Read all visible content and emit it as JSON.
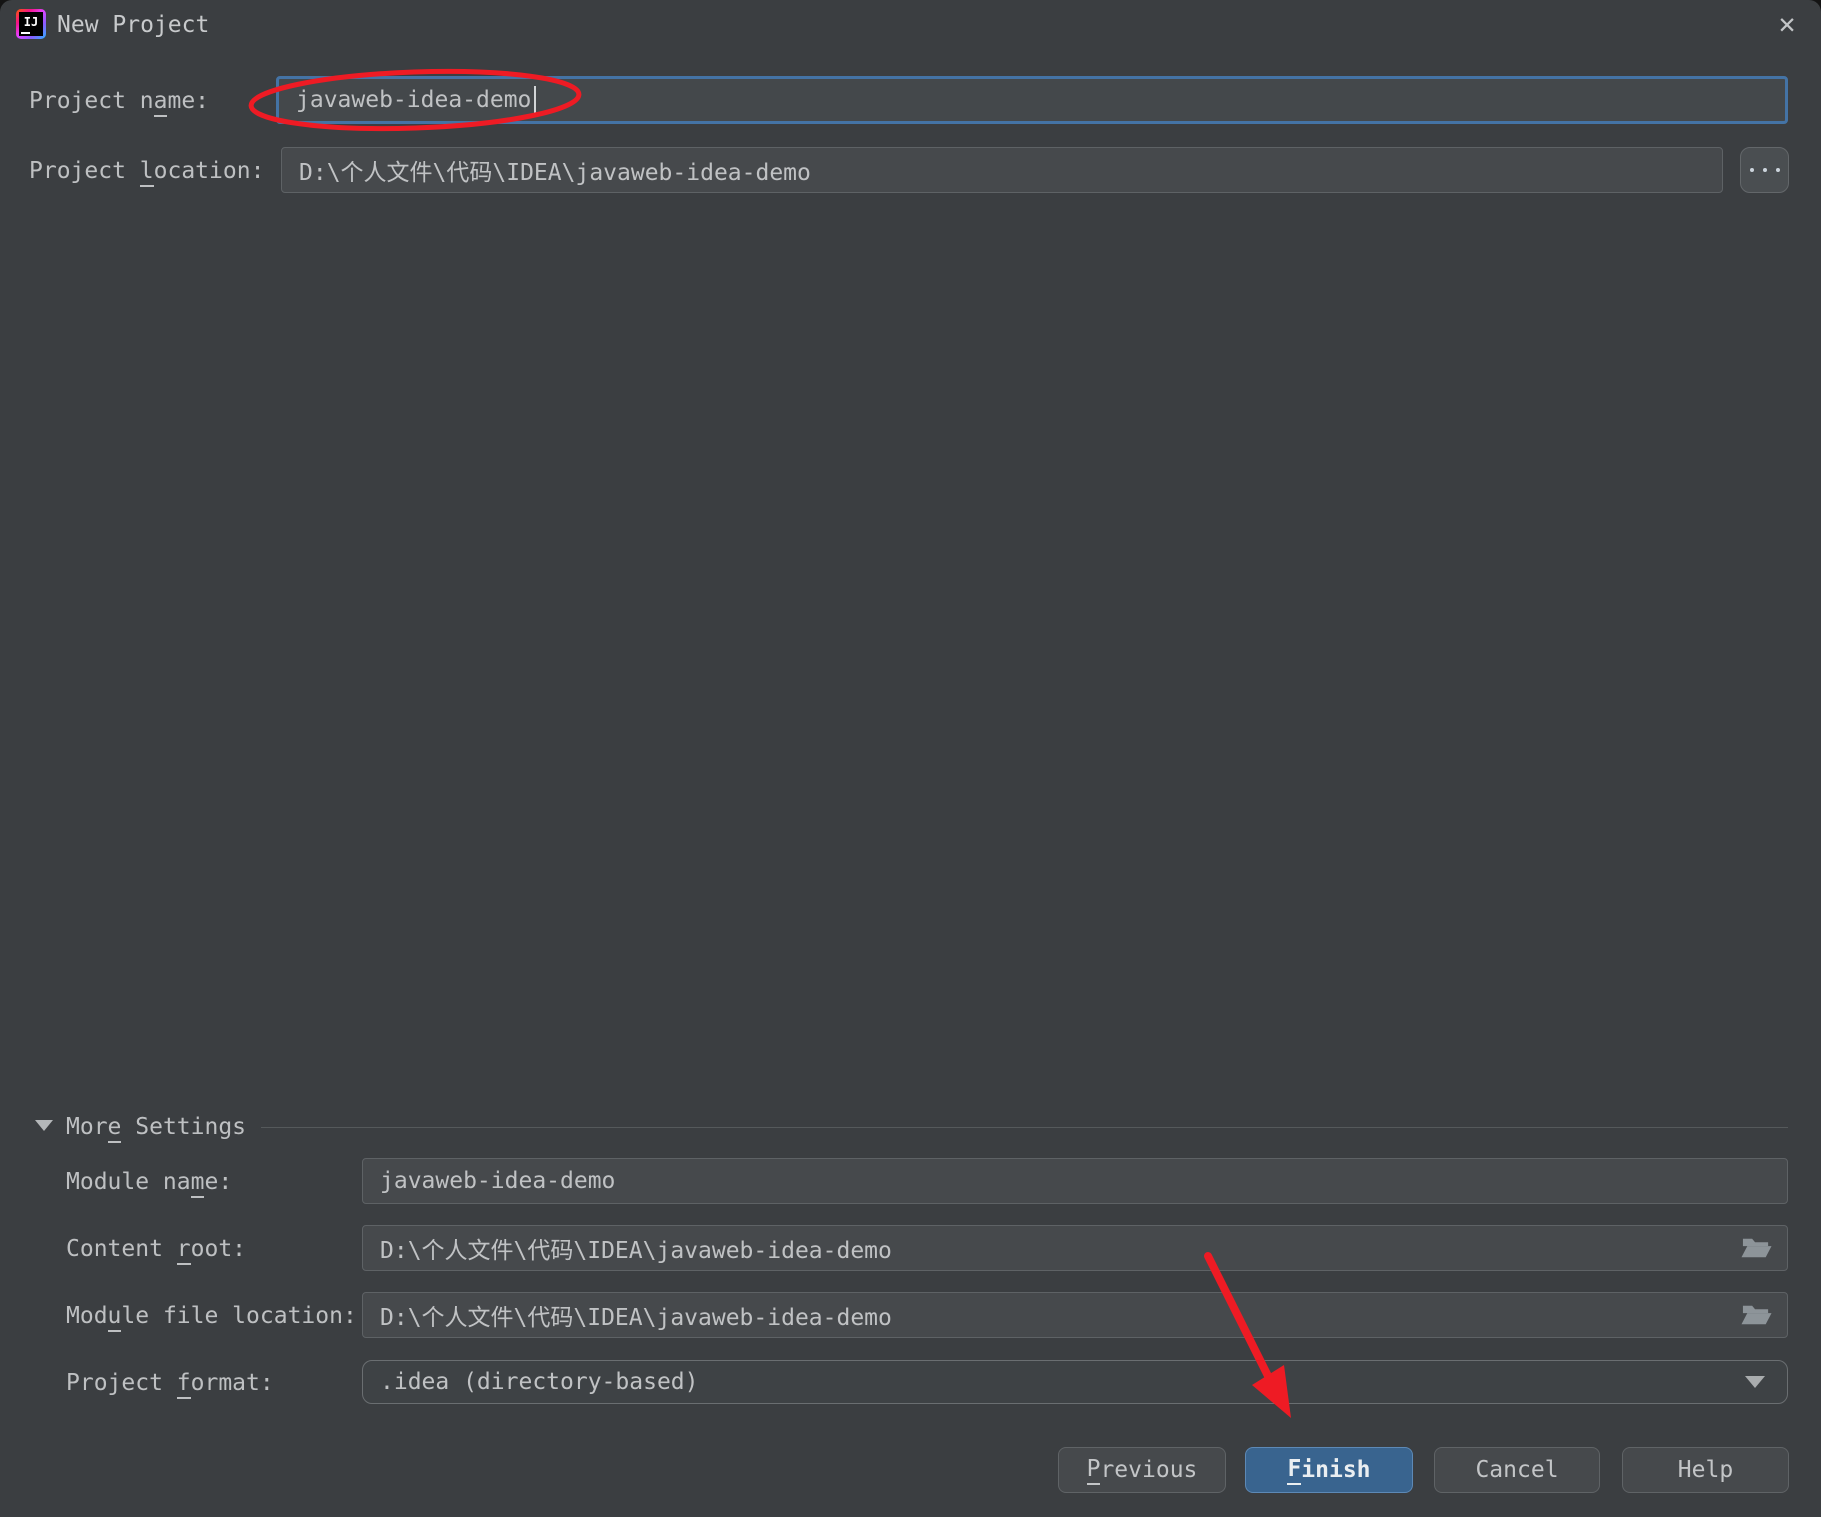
{
  "dialog": {
    "title": "New Project",
    "close_glyph": "✕"
  },
  "fields": {
    "project_name": {
      "label": "Project name:",
      "mn": 9,
      "value": "javaweb-idea-demo"
    },
    "project_location": {
      "label": "Project location:",
      "mn": 8,
      "value": "D:\\个人文件\\代码\\IDEA\\javaweb-idea-demo"
    }
  },
  "more_settings": {
    "title": "More Settings",
    "mn": 3,
    "module_name": {
      "label": "Module name:",
      "mn": 9,
      "value": "javaweb-idea-demo"
    },
    "content_root": {
      "label": "Content root:",
      "mn": 8,
      "value": "D:\\个人文件\\代码\\IDEA\\javaweb-idea-demo"
    },
    "module_file_location": {
      "label": "Module file location:",
      "mn": 3,
      "value": "D:\\个人文件\\代码\\IDEA\\javaweb-idea-demo"
    },
    "project_format": {
      "label": "Project format:",
      "mn": 8,
      "value": ".idea (directory-based)"
    }
  },
  "buttons": {
    "previous": {
      "label": "Previous",
      "mn": 0
    },
    "finish": {
      "label": "Finish",
      "mn": 0
    },
    "cancel": {
      "label": "Cancel"
    },
    "help": {
      "label": "Help"
    }
  },
  "icons": {
    "app": "intellij-idea-logo",
    "close": "close-icon",
    "browse": "ellipsis-icon",
    "collapse": "triangle-down-icon",
    "folder": "folder-open-icon",
    "dropdown": "chevron-down-icon"
  },
  "annotations": {
    "red_color": "#ee1b24",
    "ellipse_target": "project name value",
    "arrow_target": "Finish button"
  },
  "colors": {
    "dialog_bg": "#3b3e41",
    "input_bg": "#46494c",
    "focus_border": "#4473a5",
    "primary_button_bg": "#39648f",
    "text": "#bec0c2"
  }
}
